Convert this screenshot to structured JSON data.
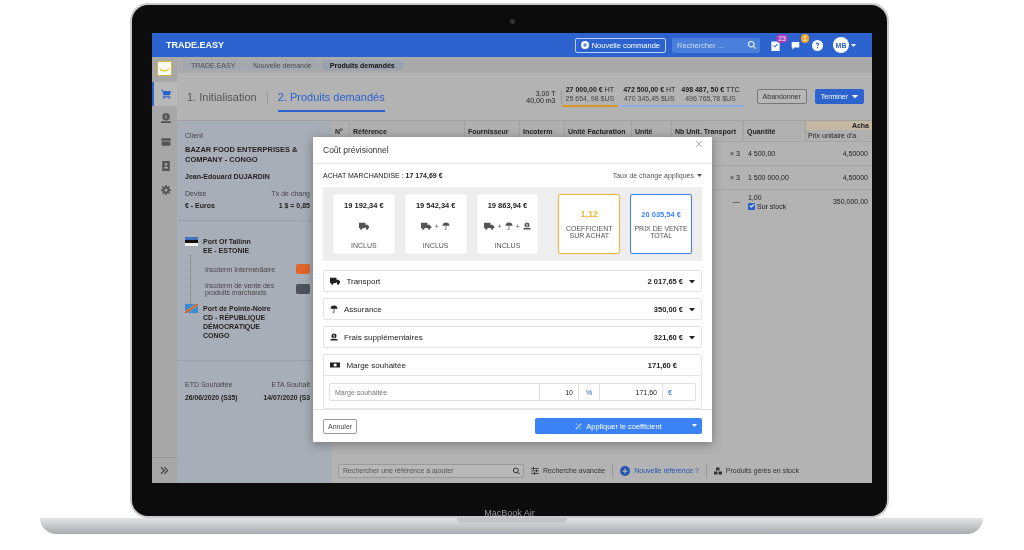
{
  "laptop": {
    "model_label": "MacBook Air"
  },
  "top_bar": {
    "brand": "TRADE.EASY",
    "new_order_button": "Nouvelle commande",
    "search": {
      "placeholder": "Rechercher ..."
    },
    "icons": [
      {
        "kind": "tasks",
        "badge": "23",
        "color": "#a03cc0"
      },
      {
        "kind": "chat",
        "badge": "1",
        "color": "#f2a623"
      },
      {
        "kind": "help"
      },
      {
        "kind": "avatar",
        "initials": "MB"
      }
    ]
  },
  "sidebar": {
    "items": [
      {
        "kind": "cart",
        "selected": true
      },
      {
        "kind": "money",
        "selected": false
      },
      {
        "kind": "store",
        "selected": false
      },
      {
        "kind": "contact",
        "selected": false
      },
      {
        "kind": "settings",
        "selected": false
      }
    ]
  },
  "breadcrumb": [
    {
      "label": "TRADE.EASY",
      "selected": false
    },
    {
      "label": "Nouvelle demande",
      "selected": false
    },
    {
      "label": "Produits demandés",
      "selected": true
    }
  ],
  "steps": [
    {
      "label": "1. Initialisation",
      "selected": false
    },
    {
      "label": "2. Produits demandés",
      "selected": true
    }
  ],
  "weight": [
    {
      "value": "3,00",
      "unit": "T"
    },
    {
      "value": "40,00",
      "unit": "m3"
    }
  ],
  "amount_groups": [
    {
      "color": "#d9962a",
      "columns": [
        {
          "main": "27 000,00 €",
          "suffix": "HT",
          "sub": "25 654, 98 $US"
        }
      ]
    },
    {
      "color": "#8fb1e6",
      "columns": [
        {
          "main": "472 500,00 €",
          "suffix": "HT",
          "sub": "470 345,45 $US"
        },
        {
          "main": "498 487, 50 €",
          "suffix": "TTC",
          "sub": "496 765,78 $US"
        }
      ]
    }
  ],
  "abandon_button": "Abandonner",
  "finish_button": "Terminer",
  "client": {
    "label": "Client",
    "name": "BAZAR FOOD ENTERPRISES & COMPANY - CONGO",
    "contact": "Jean-Edouard DUJARDIN"
  },
  "currency": [
    {
      "label": "Devise",
      "value": "€ - Euros"
    },
    {
      "label": "Tx de chang",
      "value": "1 $ = 0,85"
    }
  ],
  "route": {
    "origin": {
      "name": "Port Of Tallinn",
      "country_lines": [
        "EE - ESTONIE"
      ]
    },
    "incoterms": [
      {
        "label": "Incoterm Intermédiaire",
        "color": "#e0662a"
      },
      {
        "label": "Incoterm de vente des produits marchands",
        "color": "#4e535b"
      }
    ],
    "destination": {
      "name": "Port de Pointe-Noire",
      "country_lines": [
        "CD - RÉPUBLIQUE DÉMOCRATIQUE",
        "CONGO"
      ]
    }
  },
  "dates": [
    {
      "label": "ETD Souhaitée",
      "value": "26/06/2020 (S35)"
    },
    {
      "label": "ETA Souhait",
      "value": "14/07/2020 (S3"
    }
  ],
  "table": {
    "columns": [
      "N°",
      "Référence",
      "Fournisseur",
      "Incoterm",
      "Unité Facturation",
      "Unité",
      "Nb Unit. Transport",
      "Quantité"
    ],
    "group_header": "Acha",
    "group_column": "Prix unitaire d'a",
    "rows": [
      {
        "nb_units": "×  3",
        "quantity": "4 500,00",
        "unit_price": "4,50000"
      },
      {
        "nb_units": "×  3",
        "quantity": "1 500 000,00",
        "unit_price": "4,50000"
      },
      {
        "nb_units": "—",
        "quantity": "1,00",
        "stock": {
          "label": "Sur stock",
          "checked": true
        },
        "unit_price": "350,000,00"
      }
    ]
  },
  "bottom_bar": {
    "search": {
      "placeholder": "Rechercher une référence à ajouter"
    },
    "advanced_search": "Recherche avancée",
    "new_reference": "Nouvelle référence ?",
    "stock_products": "Produits gérés en stock"
  },
  "modal": {
    "title": "Coût prévisionnel",
    "purchase": "ACHAT MARCHANDISE : **17 174,69 €**",
    "exchange_rates": "Taux de change appliqués",
    "cards": [
      {
        "kind": "amount",
        "value": "19 192,34 €",
        "transport": true,
        "insurance": false,
        "fees": false,
        "caption": "INCLUS"
      },
      {
        "kind": "amount",
        "value": "19 542,34 €",
        "transport": true,
        "insurance": true,
        "fees": false,
        "separator": "+",
        "caption": "INCLUS"
      },
      {
        "kind": "amount",
        "value": "19 863,94 €",
        "transport": true,
        "insurance": true,
        "fees": true,
        "separator": "+",
        "caption": "INCLUS"
      },
      {
        "kind": "coefficient",
        "value": "1,12",
        "caption": "COEFFICIENT SUR ACHAT"
      },
      {
        "kind": "total",
        "value": "20 035,54 €",
        "caption": "PRIX DE VENTE TOTAL"
      }
    ],
    "sections": [
      {
        "kind": "transport",
        "label": "Transport",
        "amount": "2 017,65 €",
        "expanded": false
      },
      {
        "kind": "insurance",
        "label": "Assurance",
        "amount": "350,00 €",
        "expanded": false
      },
      {
        "kind": "fees",
        "label": "Frais supplémentaires",
        "amount": "321,60 €",
        "expanded": false
      },
      {
        "kind": "margin",
        "label": "Marge souhaitée",
        "amount": "171,60 €",
        "expanded": true
      }
    ],
    "margin_fields": {
      "label": "Marge souhaitée",
      "percent": "10",
      "percent_unit": "%",
      "amount": "171,60",
      "amount_unit": "€"
    },
    "cancel_button": "Annuler",
    "apply_button": "Appliquer le coefficient"
  }
}
